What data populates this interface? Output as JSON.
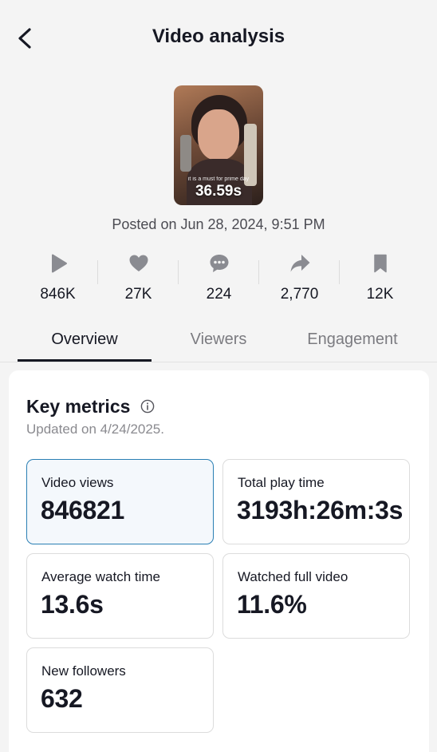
{
  "header": {
    "title": "Video analysis"
  },
  "video": {
    "duration": "36.59s",
    "caption": "it is a must for prime day",
    "posted": "Posted on Jun 28, 2024, 9:51 PM"
  },
  "stats": [
    {
      "icon": "play-icon",
      "value": "846K"
    },
    {
      "icon": "heart-icon",
      "value": "27K"
    },
    {
      "icon": "comment-icon",
      "value": "224"
    },
    {
      "icon": "share-icon",
      "value": "2,770"
    },
    {
      "icon": "bookmark-icon",
      "value": "12K"
    }
  ],
  "tabs": [
    {
      "label": "Overview",
      "active": true
    },
    {
      "label": "Viewers",
      "active": false
    },
    {
      "label": "Engagement",
      "active": false
    }
  ],
  "key_metrics": {
    "title": "Key metrics",
    "updated": "Updated on 4/24/2025.",
    "metrics": [
      {
        "label": "Video views",
        "value": "846821",
        "selected": true
      },
      {
        "label": "Total play time",
        "value": "3193h:26m:3s",
        "selected": false
      },
      {
        "label": "Average watch time",
        "value": "13.6s",
        "selected": false
      },
      {
        "label": "Watched full video",
        "value": "11.6%",
        "selected": false
      },
      {
        "label": "New followers",
        "value": "632",
        "selected": false
      }
    ]
  },
  "colors": {
    "text": "#161823",
    "muted": "#8a8a8f",
    "selected_border": "#2a7fb4",
    "icon_gray": "#8a8b91"
  }
}
